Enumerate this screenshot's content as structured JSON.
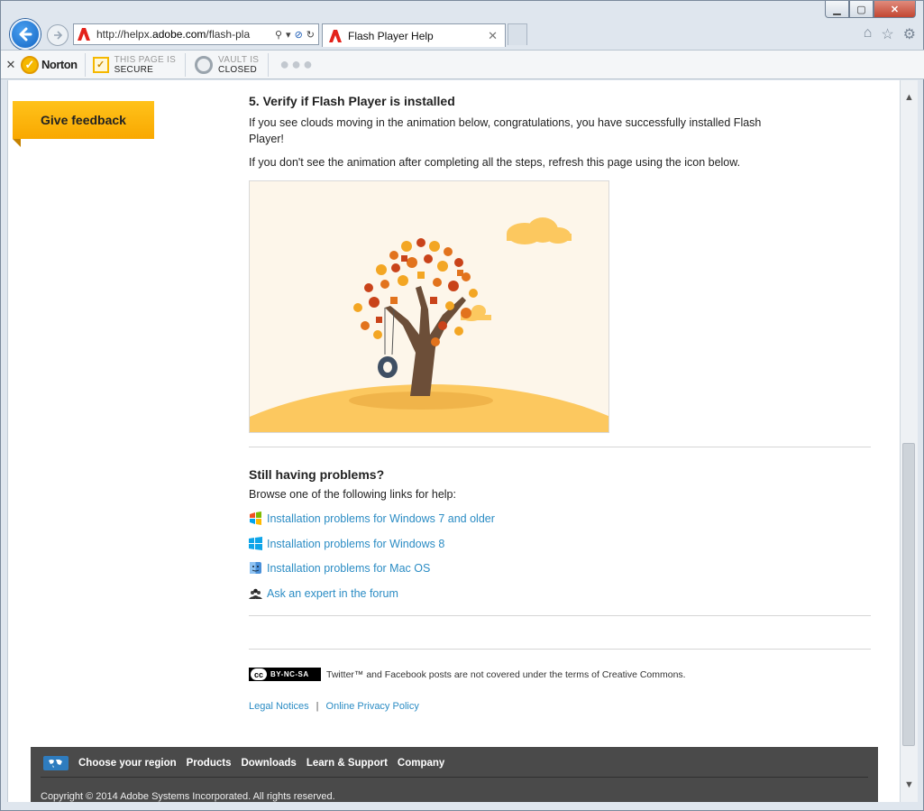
{
  "browser": {
    "window_controls": {
      "minimize": "▁",
      "maximize": "▢",
      "close": "✕"
    },
    "address": {
      "prefix": "http://helpx.",
      "domain": "adobe.com",
      "suffix": "/flash-pla"
    },
    "tab": {
      "title": "Flash Player Help",
      "close": "✕"
    },
    "right_icons": {
      "home": "⌂",
      "favorites": "☆",
      "settings": "⚙"
    }
  },
  "norton_bar": {
    "close": "✕",
    "brand": "Norton",
    "secure_line1": "THIS PAGE IS",
    "secure_line2": "SECURE",
    "vault_line1": "VAULT IS",
    "vault_line2": "CLOSED",
    "more": "●●●"
  },
  "sidebar": {
    "feedback_label": "Give feedback"
  },
  "page": {
    "step_title": "5. Verify if Flash Player is installed",
    "para1": "If you see clouds moving in the animation below, congratulations, you have successfully installed Flash",
    "para1b": "Player!",
    "para2": "If you don't see the animation after completing all the steps, refresh this page using the icon below.",
    "still_title": "Still having problems?",
    "still_sub": "Browse one of the following links for help:",
    "links": [
      {
        "label": "Installation problems for Windows 7 and older",
        "icon": "windows7-icon"
      },
      {
        "label": "Installation problems for Windows 8",
        "icon": "windows8-icon"
      },
      {
        "label": "Installation problems for Mac OS",
        "icon": "macos-icon"
      },
      {
        "label": "Ask an expert in the forum",
        "icon": "forum-icon"
      }
    ],
    "cc_badge": {
      "cc": "cc",
      "text": "BY-NC-SA"
    },
    "cc_text": "Twitter™ and Facebook posts are not covered under the terms of Creative Commons.",
    "legal_notices": "Legal Notices",
    "legal_sep": "|",
    "privacy_policy": "Online Privacy Policy"
  },
  "footer": {
    "region": "Choose your region",
    "products": "Products",
    "downloads": "Downloads",
    "learn_support": "Learn & Support",
    "company": "Company",
    "copyright": "Copyright © 2014 Adobe Systems Incorporated. All rights reserved."
  },
  "colors": {
    "link": "#2b8cc4",
    "feedback": "#ffb400",
    "footer_bg": "#4a4a4a"
  }
}
